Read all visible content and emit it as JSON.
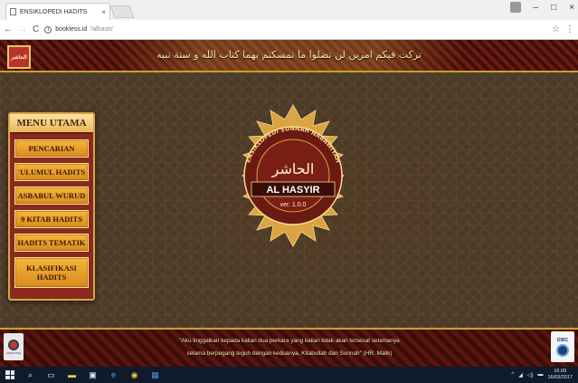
{
  "browser": {
    "tab_title": "ENSIKLOPEDI HADITS",
    "tab_close": "×",
    "url_host": "bookless.id",
    "url_path": "/alhasir/",
    "window_controls": [
      "–",
      "□",
      "×"
    ]
  },
  "app": {
    "logo_text": "الحاشر",
    "header_arabic": "تركت فيكم امرين لن تضلوا ما تمسكتم بهما كتاب الله و سنة نبيه",
    "menu": {
      "title": "MENU UTAMA",
      "items": [
        {
          "label": "PENCARIAN"
        },
        {
          "label": "'ULUMUL HADITS"
        },
        {
          "label": "ASBABUL WURUD"
        },
        {
          "label": "9 KITAB HADITS"
        },
        {
          "label": "HADITS TEMATIK"
        },
        {
          "label": "KLASIFIKASI HADITS"
        }
      ]
    },
    "emblem": {
      "arc_text": "ENSIKLOPEDI SUNNAH NABAWIYAH",
      "arabic_name": "الحاشر",
      "name": "AL HASYIR",
      "version": "ver. 1.0.0"
    },
    "footer": {
      "quote_line1": "\"Aku tinggalkan kepada kalian dua perkara yang kalian tidak akan tersesat selamanya",
      "quote_line2": "selama berpegang teguh dengan keduanya, Kitabullah dan Sunnah\" (HR. Malik)",
      "left_logo_label": "ALMUSTAQ",
      "right_logo_label": "iDBC"
    }
  },
  "taskbar": {
    "clock_time": "16.09",
    "clock_date": "16/03/2017"
  },
  "colors": {
    "menu_button": "#e9a12b",
    "menu_bg": "#8a2a1f",
    "gold": "#d6a64a",
    "header_band": "#5a150f"
  }
}
